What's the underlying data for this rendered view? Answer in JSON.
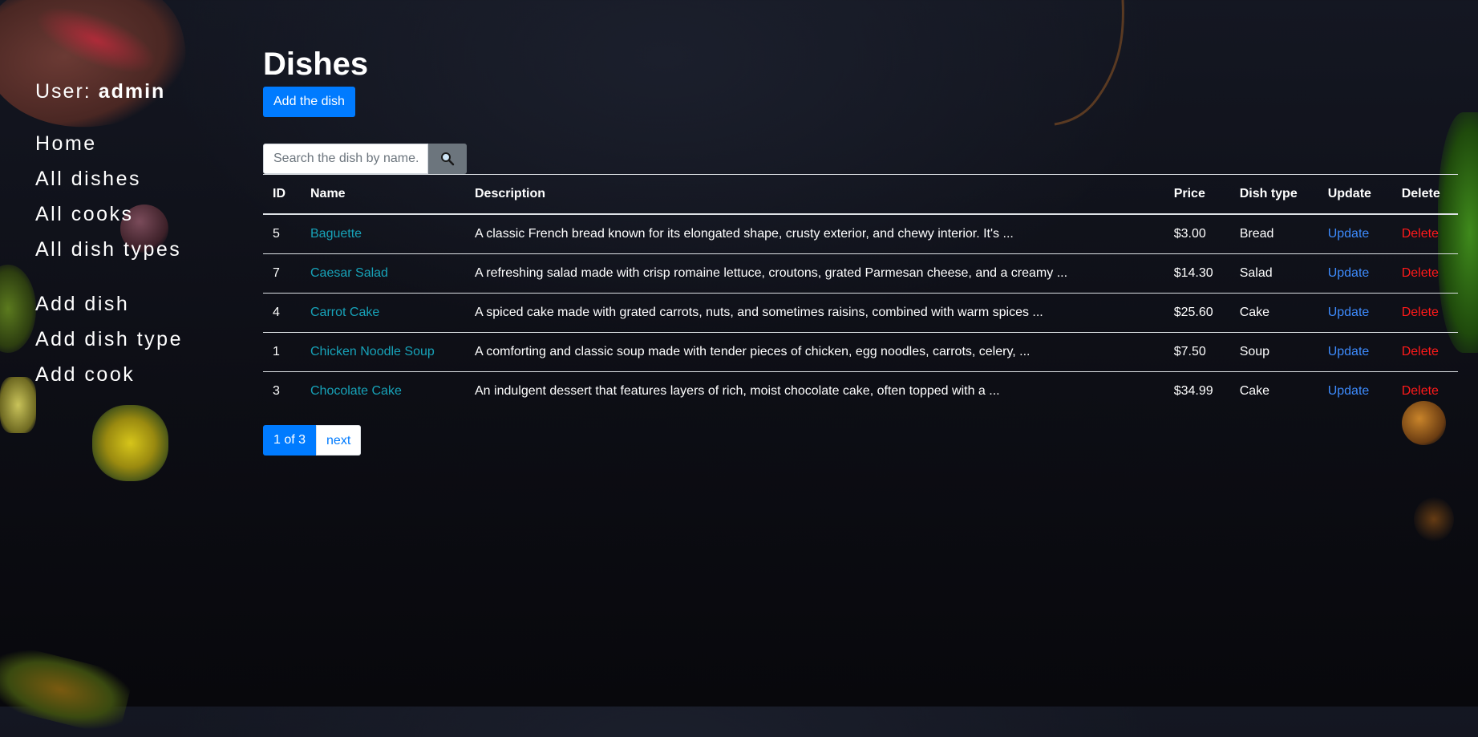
{
  "sidebar": {
    "user_prefix": "User:",
    "username": "admin",
    "nav": [
      {
        "label": "Home"
      },
      {
        "label": "All dishes"
      },
      {
        "label": "All cooks"
      },
      {
        "label": "All dish types"
      }
    ],
    "actions": [
      {
        "label": "Add dish"
      },
      {
        "label": "Add dish type"
      },
      {
        "label": "Add cook"
      }
    ]
  },
  "main": {
    "title": "Dishes",
    "add_button": "Add the dish",
    "search": {
      "placeholder": "Search the dish by name..",
      "button_icon": "search-icon"
    },
    "table": {
      "headers": [
        "ID",
        "Name",
        "Description",
        "Price",
        "Dish type",
        "Update",
        "Delete"
      ],
      "rows": [
        {
          "id": "5",
          "name": "Baguette",
          "description": "A classic French bread known for its elongated shape, crusty exterior, and chewy interior. It's ...",
          "price": "$3.00",
          "type": "Bread",
          "update": "Update",
          "delete": "Delete"
        },
        {
          "id": "7",
          "name": "Caesar Salad",
          "description": "A refreshing salad made with crisp romaine lettuce, croutons, grated Parmesan cheese, and a creamy ...",
          "price": "$14.30",
          "type": "Salad",
          "update": "Update",
          "delete": "Delete"
        },
        {
          "id": "4",
          "name": "Carrot Cake",
          "description": "A spiced cake made with grated carrots, nuts, and sometimes raisins, combined with warm spices ...",
          "price": "$25.60",
          "type": "Cake",
          "update": "Update",
          "delete": "Delete"
        },
        {
          "id": "1",
          "name": "Chicken Noodle Soup",
          "description": "A comforting and classic soup made with tender pieces of chicken, egg noodles, carrots, celery, ...",
          "price": "$7.50",
          "type": "Soup",
          "update": "Update",
          "delete": "Delete"
        },
        {
          "id": "3",
          "name": "Chocolate Cake",
          "description": "An indulgent dessert that features layers of rich, moist chocolate cake, often topped with a ...",
          "price": "$34.99",
          "type": "Cake",
          "update": "Update",
          "delete": "Delete"
        }
      ]
    },
    "pagination": {
      "current": "1 of 3",
      "next": "next"
    }
  },
  "colors": {
    "primary": "#007bff",
    "name_link": "#17a2b8",
    "update_link": "#3d8bfd",
    "delete_link": "#ff1a1a",
    "search_button": "#6c757d"
  }
}
